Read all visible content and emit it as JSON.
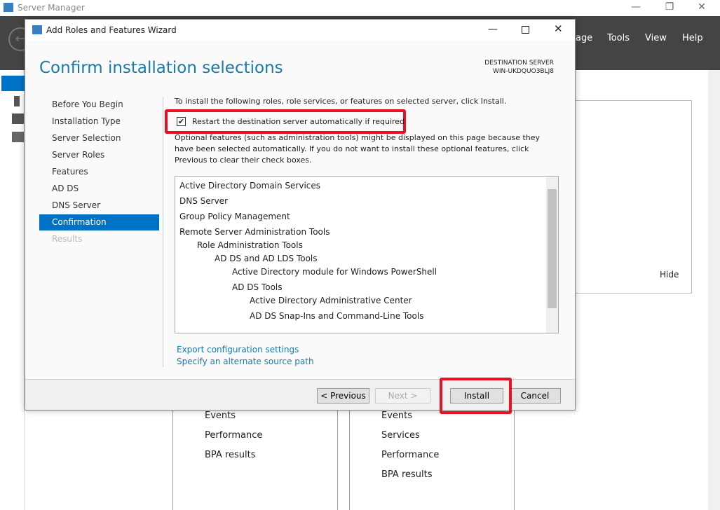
{
  "server_manager": {
    "title": "Server Manager",
    "menu": [
      "age",
      "Tools",
      "View",
      "Help"
    ],
    "hide_label": "Hide",
    "tile1": [
      "Events",
      "Performance",
      "BPA results"
    ],
    "tile2": [
      "Events",
      "Services",
      "Performance",
      "BPA results"
    ]
  },
  "wizard": {
    "title": "Add Roles and Features Wizard",
    "heading": "Confirm installation selections",
    "destination_label": "DESTINATION SERVER",
    "destination_server": "WIN-UKDQUO3BLJ8",
    "nav": [
      "Before You Begin",
      "Installation Type",
      "Server Selection",
      "Server Roles",
      "Features",
      "AD DS",
      "DNS Server",
      "Confirmation",
      "Results"
    ],
    "intro": "To install the following roles, role services, or features on selected server, click Install.",
    "restart_label": "Restart the destination server automatically if required",
    "restart_checked": true,
    "optional_note": "Optional features (such as administration tools) might be displayed on this page because they have been selected automatically. If you do not want to install these optional features, click Previous to clear their check boxes.",
    "items": [
      "Active Directory Domain Services",
      "DNS Server",
      "Group Policy Management",
      "Remote Server Administration Tools",
      "Role Administration Tools",
      "AD DS and AD LDS Tools",
      "Active Directory module for Windows PowerShell",
      "AD DS Tools",
      "Active Directory Administrative Center",
      "AD DS Snap-Ins and Command-Line Tools"
    ],
    "links": [
      "Export configuration settings",
      "Specify an alternate source path"
    ],
    "buttons": {
      "previous": "< Previous",
      "next": "Next >",
      "install": "Install",
      "cancel": "Cancel"
    }
  }
}
